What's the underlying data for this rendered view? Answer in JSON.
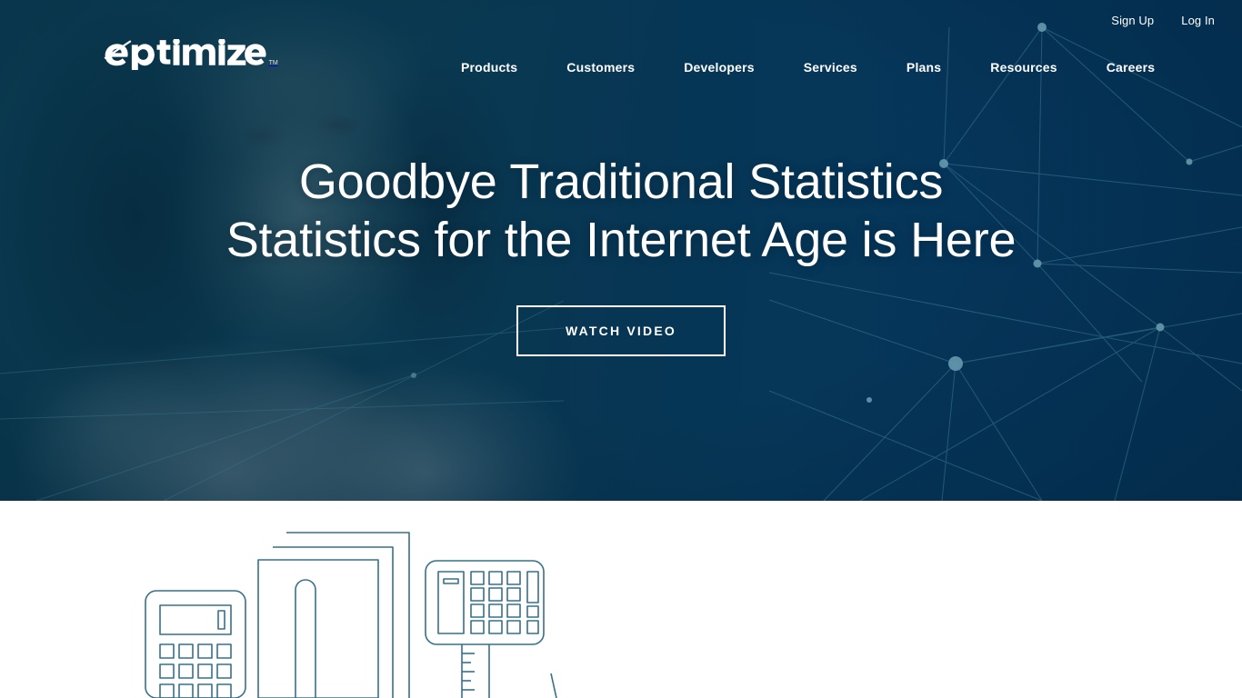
{
  "brand": {
    "name": "Optimizely",
    "trademark": "TM",
    "logo_icon": "optimizely-logo"
  },
  "colors": {
    "hero_background": "#05365a",
    "hero_deep": "#043155",
    "hero_teal": "#0d4a5e",
    "text_on_dark": "#ffffff",
    "network_node": "#5f93a6",
    "network_line": "#2f6a82",
    "illustration_stroke": "#36708a",
    "white_section": "#ffffff"
  },
  "topbar": {
    "links": [
      {
        "label": "Sign Up",
        "name": "sign-up-link"
      },
      {
        "label": "Log In",
        "name": "log-in-link"
      }
    ]
  },
  "nav": {
    "items": [
      {
        "label": "Products"
      },
      {
        "label": "Customers"
      },
      {
        "label": "Developers"
      },
      {
        "label": "Services"
      },
      {
        "label": "Plans"
      },
      {
        "label": "Resources"
      },
      {
        "label": "Careers"
      }
    ]
  },
  "hero": {
    "headline_line1": "Goodbye Traditional Statistics",
    "headline_line2": "Statistics for the Internet Age is Here",
    "cta_label": "WATCH VIDEO",
    "background_media": "portrait-photo-with-teal-overlay",
    "decoration": "network-constellation"
  },
  "illustration": {
    "description": "line-art-office-objects",
    "objects": [
      "calculator",
      "document-stack",
      "keypad-calculator",
      "ruler"
    ]
  }
}
